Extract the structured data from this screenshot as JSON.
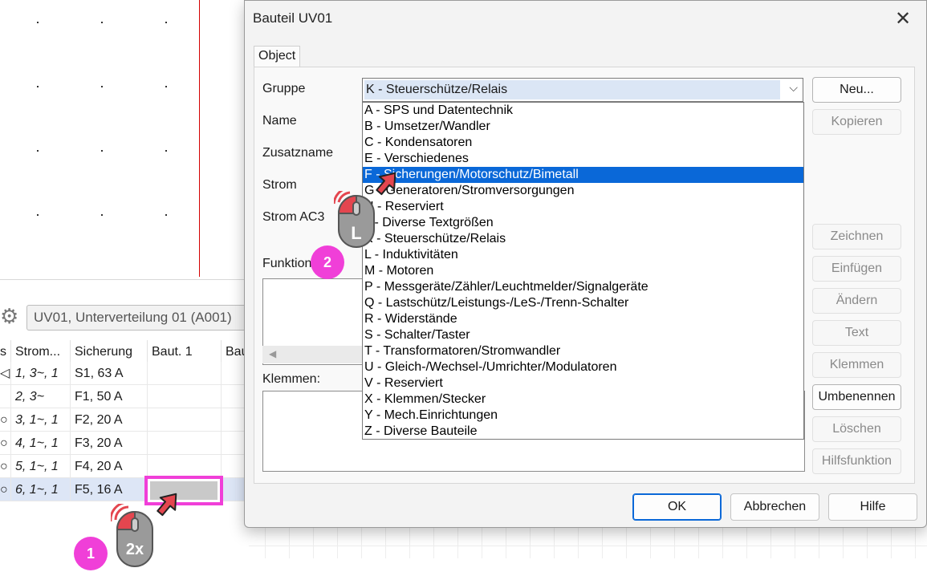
{
  "dialog": {
    "title": "Bauteil UV01",
    "close_glyph": "✕",
    "tab_object": "Object",
    "labels": {
      "gruppe": "Gruppe",
      "name": "Name",
      "zusatzname": "Zusatzname",
      "strom": "Strom",
      "strom_ac3": "Strom AC3",
      "funktion": "Funktion",
      "klemmen": "Klemmen:"
    },
    "combo": {
      "value": "K - Steuerschütze/Relais",
      "arrow": "⌵"
    },
    "options": [
      "A - SPS und Datentechnik",
      "B - Umsetzer/Wandler",
      "C - Kondensatoren",
      "E - Verschiedenes",
      "F - Sicherungen/Motorschutz/Bimetall",
      "G - Generatoren/Stromversorgungen",
      "H - Reserviert",
      "J - Diverse Textgrößen",
      "K - Steuerschütze/Relais",
      "L - Induktivitäten",
      "M - Motoren",
      "P - Messgeräte/Zähler/Leuchtmelder/Signalgeräte",
      "Q - Lastschütz/Leistungs-/LeS-/Trenn-Schalter",
      "R - Widerstände",
      "S - Schalter/Taster",
      "T - Transformatoren/Stromwandler",
      "U - Gleich-/Wechsel-/Umrichter/Modulatoren",
      "V - Reserviert",
      "X - Klemmen/Stecker",
      "Y - Mech.Einrichtungen",
      "Z - Diverse Bauteile"
    ],
    "highlighted_option_index": 4,
    "side_buttons": {
      "neu": "Neu...",
      "kopieren": "Kopieren",
      "zeichnen": "Zeichnen",
      "einfuegen": "Einfügen",
      "aendern": "Ändern",
      "text": "Text",
      "klemmen": "Klemmen",
      "umbenennen": "Umbenennen",
      "loeschen": "Löschen",
      "hilfsfunktion": "Hilfsfunktion"
    },
    "bottom_buttons": {
      "ok": "OK",
      "abbrechen": "Abbrechen",
      "hilfe": "Hilfe"
    }
  },
  "table_panel": {
    "path": "UV01, Unterverteilung 01 (A001)",
    "columns": [
      "s",
      "Strom...",
      "Sicherung",
      "Baut. 1",
      "Bau"
    ],
    "rows": [
      {
        "mark": "◁",
        "strom": "1, 3~, 1",
        "sicherung": "S1, 63 A"
      },
      {
        "mark": "",
        "strom": "2, 3~",
        "sicherung": "F1, 50 A"
      },
      {
        "mark": "○",
        "strom": "3, 1~, 1",
        "sicherung": "F2, 20 A"
      },
      {
        "mark": "○",
        "strom": "4, 1~, 1",
        "sicherung": "F3, 20 A"
      },
      {
        "mark": "○",
        "strom": "5, 1~, 1",
        "sicherung": "F4, 20 A"
      },
      {
        "mark": "○",
        "strom": "6, 1~, 1",
        "sicherung": "F5, 16 A"
      }
    ],
    "selected_row_index": 5
  },
  "overlays": {
    "badge_1": "1",
    "badge_2": "2",
    "mouse_double_click": "2x",
    "mouse_left_click": "L",
    "accent_color": "#f03fd8",
    "mouse_color": "#e4464f"
  }
}
